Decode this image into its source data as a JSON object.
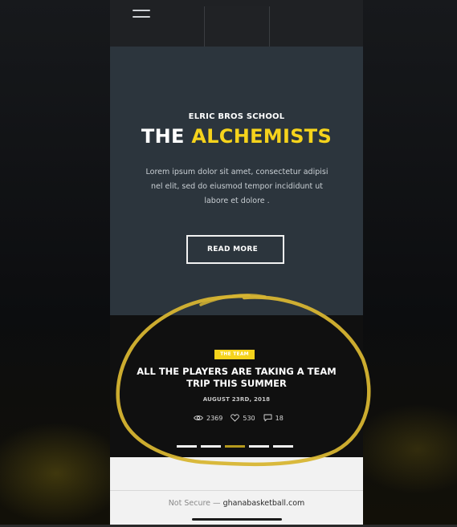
{
  "colors": {
    "accent": "#f5d31c",
    "hero_bg": "#2c353d",
    "slide_bg": "#101010",
    "annotation": "#d7b531"
  },
  "nav": {
    "menu_icon": "hamburger-menu-icon"
  },
  "hero": {
    "eyebrow": "ELRIC BROS SCHOOL",
    "title_main": "THE",
    "title_accent": "ALCHEMISTS",
    "body": "Lorem ipsum dolor sit amet, consectetur adipisi nel elit, sed do eiusmod tempor incididunt ut labore et dolore .",
    "button_label": "READ MORE"
  },
  "slide": {
    "tag": "THE TEAM",
    "title": "ALL THE PLAYERS ARE TAKING A TEAM TRIP THIS SUMMER",
    "date": "AUGUST 23RD, 2018",
    "stats": {
      "views": "2369",
      "likes": "530",
      "comments": "18"
    },
    "dots": [
      "slide-1",
      "slide-2",
      "slide-3",
      "slide-4",
      "slide-5"
    ],
    "active_dot": 3
  },
  "browser": {
    "security_text": "Not Secure —",
    "domain": "ghanabasketball.com"
  }
}
